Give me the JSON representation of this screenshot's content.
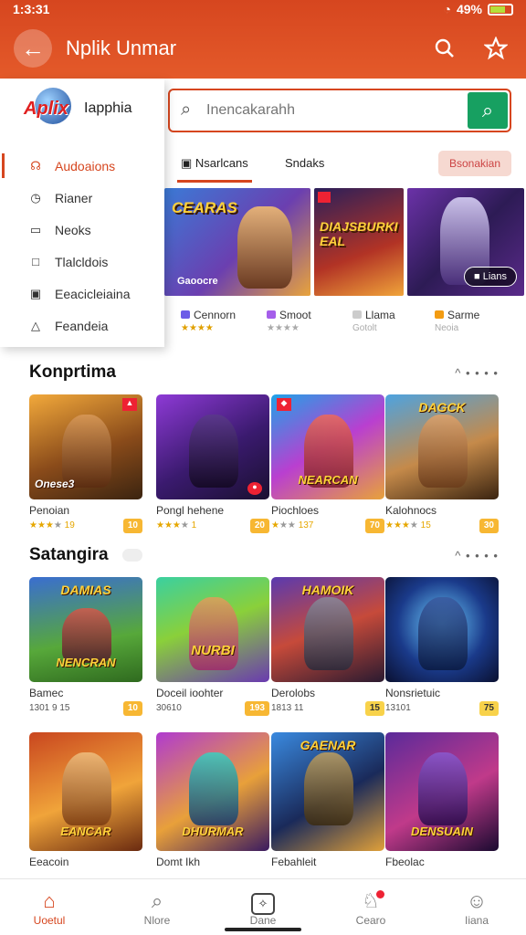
{
  "status": {
    "time": "1:3:31",
    "battery": "49%"
  },
  "appbar": {
    "title": "Nplik Unmar"
  },
  "drawer": {
    "logo_text": "Aplix",
    "brand": "Iapphia",
    "items": [
      {
        "label": "Audoaions",
        "icon": "gamepad-icon"
      },
      {
        "label": "Rianer",
        "icon": "clock-icon"
      },
      {
        "label": "Neoks",
        "icon": "chart-icon"
      },
      {
        "label": "Tlalcldois",
        "icon": "square-icon"
      },
      {
        "label": "Eeacicleiaina",
        "icon": "calendar-icon"
      },
      {
        "label": "Feandeia",
        "icon": "triangle-icon"
      }
    ]
  },
  "search": {
    "placeholder": "Inencakarahh"
  },
  "tabs": {
    "tab1": "Nsarlcans",
    "tab2": "Sndaks",
    "button": "Bsonakian"
  },
  "banners": [
    {
      "title": "CEARAS",
      "label": "Gaoocre"
    },
    {
      "title": "DIAJSBURKIEAL"
    },
    {
      "pill": "Lians"
    }
  ],
  "banner_captions": [
    {
      "name": "Cennorn",
      "sub": "★★★★"
    },
    {
      "name": "Smoot",
      "sub": "★★★★"
    },
    {
      "name": "Llama",
      "sub": "Gotolt"
    },
    {
      "name": "Sarme",
      "sub": "Neoia"
    }
  ],
  "section1": {
    "title": "Konprtima",
    "more": "^ • • • •",
    "cards": [
      {
        "thumb": "Onese3",
        "name": "Penoian",
        "rating": "19",
        "price": "10"
      },
      {
        "thumb": "",
        "name": "Pongl hehene",
        "rating": "1",
        "price": "20"
      },
      {
        "thumb": "NEARCAN",
        "name": "Piochloes",
        "rating": "137",
        "price": "70"
      },
      {
        "thumb": "DAGCK",
        "name": "Kalohnocs",
        "rating": "15",
        "price": "30"
      }
    ]
  },
  "section2": {
    "title": "Satangira",
    "more": "^ • • • •",
    "cards": [
      {
        "top": "DAMIAS",
        "thumb": "NENCRAN",
        "name": "Bamec",
        "rating": "1301 9 15",
        "price": "10"
      },
      {
        "top": "NURBI",
        "thumb": "",
        "name": "Doceil ioohter",
        "rating": "30610",
        "price": "193"
      },
      {
        "top": "HAMOIK",
        "thumb": "",
        "name": "Derolobs",
        "rating": "1813 11",
        "price": "15"
      },
      {
        "top": "",
        "thumb": "",
        "name": "Nonsrietuic",
        "rating": "13101",
        "price": "75"
      }
    ]
  },
  "section3": {
    "cards": [
      {
        "thumb": "EANCAR",
        "name": "Eeacoin"
      },
      {
        "thumb": "DHURMAR",
        "name": "Domt Ikh"
      },
      {
        "thumb": "GAENAR",
        "name": "Febahleit"
      },
      {
        "thumb": "DENSUAIN",
        "name": "Fbeolac"
      }
    ]
  },
  "bottom_nav": [
    {
      "label": "Uoetul",
      "icon": "home-icon"
    },
    {
      "label": "Nlore",
      "icon": "search-icon"
    },
    {
      "label": "Dane",
      "icon": "box-icon"
    },
    {
      "label": "Cearo",
      "icon": "bell-icon"
    },
    {
      "label": "Iiana",
      "icon": "profile-icon"
    }
  ]
}
